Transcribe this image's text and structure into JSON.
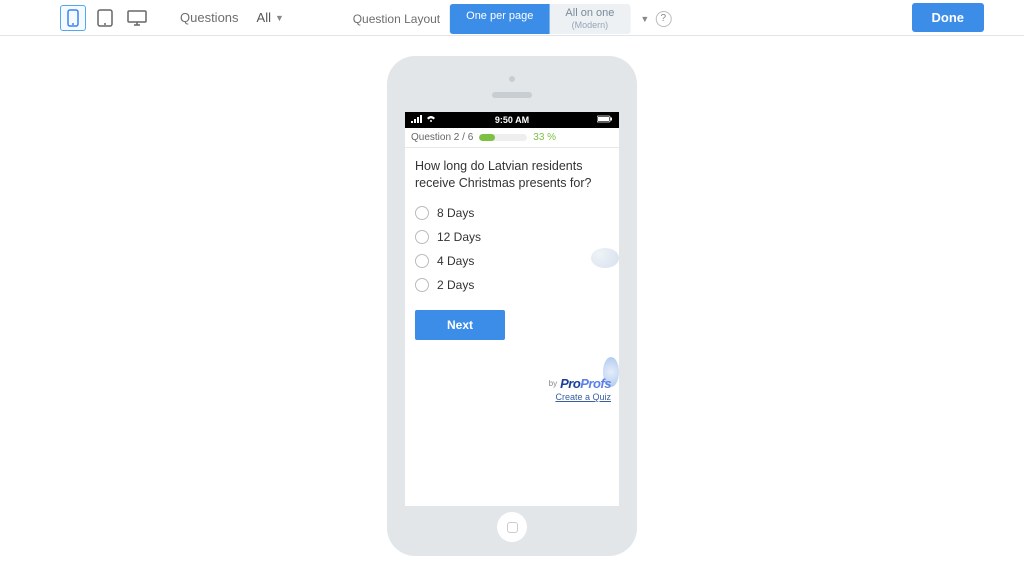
{
  "toolbar": {
    "questions_label": "Questions",
    "questions_value": "All",
    "layout_label": "Question Layout",
    "layout_options": [
      "One per page",
      "All on one"
    ],
    "layout_sub": "(Modern)",
    "done_label": "Done"
  },
  "statusbar": {
    "time": "9:50 AM"
  },
  "quiz": {
    "position_label": "Question 2 / 6",
    "progress_pct": 33,
    "progress_label": "33 %",
    "question": "How long do Latvian residents receive Christmas presents for?",
    "options": [
      "8 Days",
      "12 Days",
      "4 Days",
      "2 Days"
    ],
    "next_label": "Next"
  },
  "footer": {
    "by_label": "by",
    "logo_part1": "Pro",
    "logo_part2": "Profs",
    "create_link": "Create a Quiz"
  }
}
